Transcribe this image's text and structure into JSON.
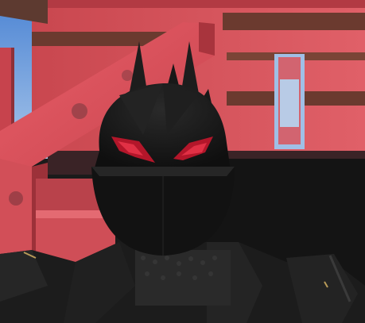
{
  "scene": {
    "subject": "character-helmet",
    "colors": {
      "sky": "#5e8fd6",
      "sky_light": "#9fc0ea",
      "structure": "#d7545d",
      "structure_dark": "#8e3038",
      "structure_shadow": "#5a2026",
      "wood_bar": "#6b3a2f",
      "helmet": "#161616",
      "helmet_edge": "#2c2c2c",
      "eye_glow": "#c0182b",
      "armor": "#1e1e1e",
      "gold_trim": "#b89a58"
    }
  }
}
